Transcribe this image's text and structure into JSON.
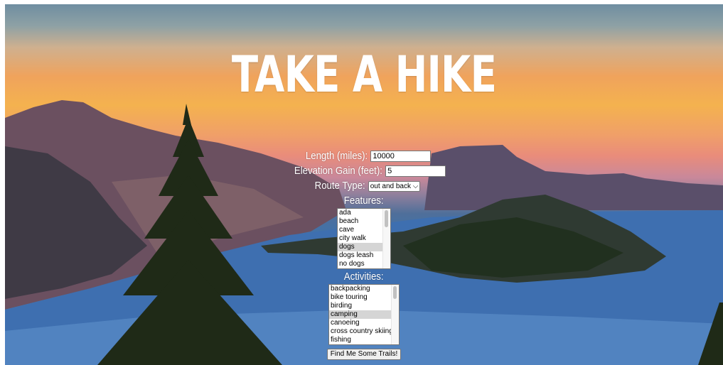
{
  "page": {
    "title": "TAKE A HIKE"
  },
  "form": {
    "length": {
      "label": "Length (miles):",
      "value": "10000"
    },
    "elevation": {
      "label": "Elevation Gain (feet):",
      "value": "5"
    },
    "route": {
      "label": "Route Type:",
      "selected": "out and back"
    },
    "features": {
      "label": "Features:",
      "options": [
        "ada",
        "beach",
        "cave",
        "city walk",
        "dogs",
        "dogs leash",
        "no dogs"
      ],
      "selected": "dogs"
    },
    "activities": {
      "label": "Activities:",
      "options": [
        "backpacking",
        "bike touring",
        "birding",
        "camping",
        "canoeing",
        "cross country skiing",
        "fishing"
      ],
      "selected": "camping"
    },
    "submit_label": "Find Me Some Trails!"
  }
}
